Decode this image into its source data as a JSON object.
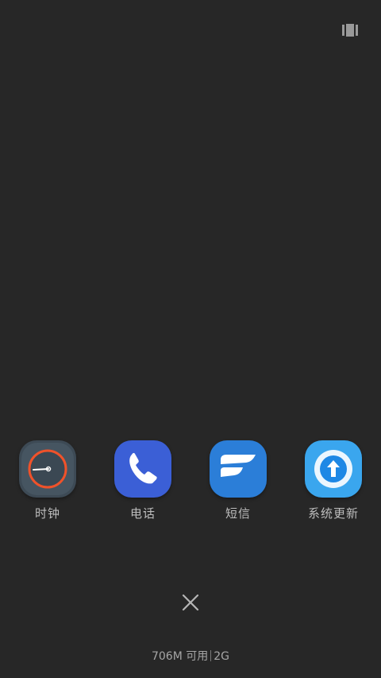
{
  "apps": [
    {
      "label": "时钟",
      "icon": "clock-icon",
      "color": "#3d4a55"
    },
    {
      "label": "电话",
      "icon": "phone-icon",
      "color": "#3b5fd6"
    },
    {
      "label": "短信",
      "icon": "message-icon",
      "color": "#2b7ed8"
    },
    {
      "label": "系统更新",
      "icon": "system-update-icon",
      "color": "#3aa6ee"
    }
  ],
  "memory": {
    "available": "706M 可用",
    "total": "2G"
  },
  "colors": {
    "background": "#272727",
    "label": "#bdbdbd",
    "clock_ring": "#f0522a"
  }
}
